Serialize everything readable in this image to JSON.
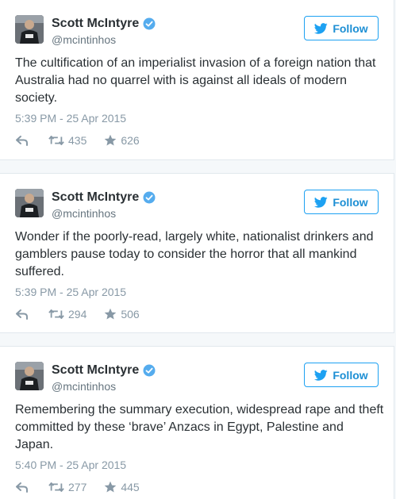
{
  "tweets": [
    {
      "name": "Scott McIntyre",
      "handle": "@mcintinhos",
      "follow_label": "Follow",
      "text": "The cultification of an imperialist invasion of a foreign nation that Australia had no quarrel with is against all ideals of modern society.",
      "timestamp": "5:39 PM - 25 Apr 2015",
      "retweets": "435",
      "favorites": "626"
    },
    {
      "name": "Scott McIntyre",
      "handle": "@mcintinhos",
      "follow_label": "Follow",
      "text": "Wonder if the poorly-read, largely white, nationalist drinkers and gamblers pause today to consider the horror that all mankind suffered.",
      "timestamp": "5:39 PM - 25 Apr 2015",
      "retweets": "294",
      "favorites": "506"
    },
    {
      "name": "Scott McIntyre",
      "handle": "@mcintinhos",
      "follow_label": "Follow",
      "text": "Remembering the summary execution, widespread rape and theft committed by these ‘brave’ Anzacs in Egypt, Palestine and Japan.",
      "timestamp": "5:40 PM - 25 Apr 2015",
      "retweets": "277",
      "favorites": "445"
    }
  ],
  "colors": {
    "accent": "#1da1f2",
    "text": "#292f33",
    "muted": "#8899a6",
    "border": "#e1e8ed"
  },
  "icons": [
    "twitter-bird-icon",
    "verified-badge-icon",
    "reply-icon",
    "retweet-icon",
    "favorite-star-icon",
    "avatar"
  ]
}
